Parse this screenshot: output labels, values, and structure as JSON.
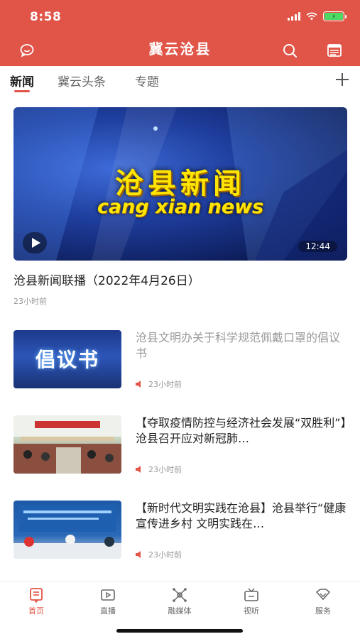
{
  "status_bar": {
    "time": "8:58"
  },
  "header": {
    "title": "冀云沧县"
  },
  "tabs": [
    "新闻",
    "冀云头条",
    "专题"
  ],
  "hero": {
    "title_overlay": "沧县新闻",
    "subtitle_overlay": "cang xian news",
    "duration": "12:44",
    "caption": "沧县新闻联播（2022年4月26日）",
    "time": "23小时前"
  },
  "news": [
    {
      "title": "沧县文明办关于科学规范佩戴口罩的倡议书",
      "time": "23小时前",
      "thumb_text": "倡议书"
    },
    {
      "title": "【夺取疫情防控与经济社会发展“双胜利”】沧县召开应对新冠肺…",
      "time": "23小时前"
    },
    {
      "title": "【新时代文明实践在沧县】沧县举行“健康宣传进乡村 文明实践在…",
      "time": "23小时前"
    }
  ],
  "tabbar": [
    "首页",
    "直播",
    "融媒体",
    "视听",
    "服务"
  ],
  "colors": {
    "brand": "#e15448",
    "battery": "#4cd964"
  }
}
